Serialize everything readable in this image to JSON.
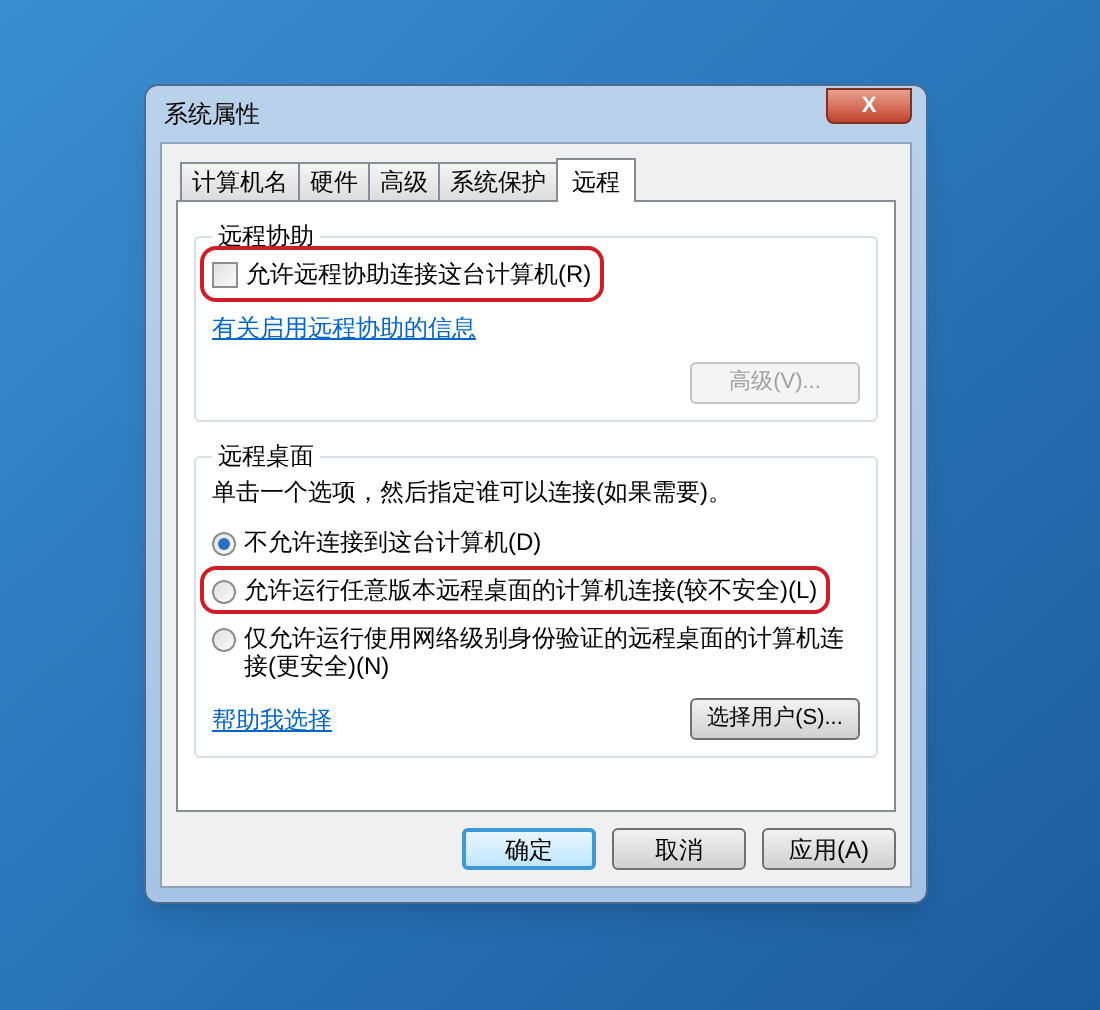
{
  "window": {
    "title": "系统属性",
    "close": "X"
  },
  "tabs": [
    {
      "label": "计算机名",
      "selected": false
    },
    {
      "label": "硬件",
      "selected": false
    },
    {
      "label": "高级",
      "selected": false
    },
    {
      "label": "系统保护",
      "selected": false
    },
    {
      "label": "远程",
      "selected": true
    }
  ],
  "remote_assistance": {
    "title": "远程协助",
    "checkbox": {
      "label": "允许远程协助连接这台计算机(R)",
      "checked": false,
      "annotated": true
    },
    "link": "有关启用远程协助的信息",
    "advanced_button": {
      "label": "高级(V)...",
      "disabled": true
    }
  },
  "remote_desktop": {
    "title": "远程桌面",
    "instruction": "单击一个选项，然后指定谁可以连接(如果需要)。",
    "options": [
      {
        "label": "不允许连接到这台计算机(D)",
        "selected": true,
        "annotated": false
      },
      {
        "label": "允许运行任意版本远程桌面的计算机连接(较不安全)(L)",
        "selected": false,
        "annotated": true
      },
      {
        "label": "仅允许运行使用网络级别身份验证的远程桌面的计算机连接(更安全)(N)",
        "selected": false,
        "annotated": false
      }
    ],
    "help_link": "帮助我选择",
    "select_users_button": "选择用户(S)..."
  },
  "buttons": [
    {
      "label": "确定",
      "default": true
    },
    {
      "label": "取消",
      "default": false
    },
    {
      "label": "应用(A)",
      "default": false
    }
  ]
}
